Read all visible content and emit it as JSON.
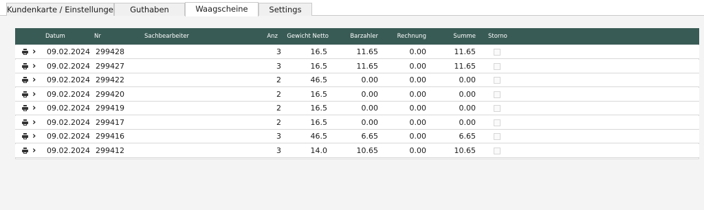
{
  "tabs": [
    {
      "label": "Kundenkarte / Einstellungen",
      "active": false
    },
    {
      "label": "Guthaben",
      "active": false
    },
    {
      "label": "Waagscheine",
      "active": true
    },
    {
      "label": "Settings",
      "active": false
    }
  ],
  "table": {
    "headers": {
      "datum": "Datum",
      "nr": "Nr",
      "sachbearbeiter": "Sachbearbeiter",
      "anz": "Anz",
      "gewicht": "Gewicht Netto",
      "barzahler": "Barzahler",
      "rechnung": "Rechnung",
      "summe": "Summe",
      "storno": "Storno"
    },
    "rows": [
      {
        "datum": "09.02.2024",
        "nr": "299428",
        "sachbearbeiter": "",
        "anz": "3",
        "gewicht": "16.5",
        "barzahler": "11.65",
        "rechnung": "0.00",
        "summe": "11.65",
        "storno": false
      },
      {
        "datum": "09.02.2024",
        "nr": "299427",
        "sachbearbeiter": "",
        "anz": "3",
        "gewicht": "16.5",
        "barzahler": "11.65",
        "rechnung": "0.00",
        "summe": "11.65",
        "storno": false
      },
      {
        "datum": "09.02.2024",
        "nr": "299422",
        "sachbearbeiter": "",
        "anz": "2",
        "gewicht": "46.5",
        "barzahler": "0.00",
        "rechnung": "0.00",
        "summe": "0.00",
        "storno": false
      },
      {
        "datum": "09.02.2024",
        "nr": "299420",
        "sachbearbeiter": "",
        "anz": "2",
        "gewicht": "16.5",
        "barzahler": "0.00",
        "rechnung": "0.00",
        "summe": "0.00",
        "storno": false
      },
      {
        "datum": "09.02.2024",
        "nr": "299419",
        "sachbearbeiter": "",
        "anz": "2",
        "gewicht": "16.5",
        "barzahler": "0.00",
        "rechnung": "0.00",
        "summe": "0.00",
        "storno": false
      },
      {
        "datum": "09.02.2024",
        "nr": "299417",
        "sachbearbeiter": "",
        "anz": "2",
        "gewicht": "16.5",
        "barzahler": "0.00",
        "rechnung": "0.00",
        "summe": "0.00",
        "storno": false
      },
      {
        "datum": "09.02.2024",
        "nr": "299416",
        "sachbearbeiter": "",
        "anz": "3",
        "gewicht": "46.5",
        "barzahler": "6.65",
        "rechnung": "0.00",
        "summe": "6.65",
        "storno": false
      },
      {
        "datum": "09.02.2024",
        "nr": "299412",
        "sachbearbeiter": "",
        "anz": "3",
        "gewicht": "14.0",
        "barzahler": "10.65",
        "rechnung": "0.00",
        "summe": "10.65",
        "storno": false
      }
    ],
    "row_icons": [
      "printer-icon",
      "chevron-right-icon"
    ]
  },
  "colors": {
    "header_bg": "#395b55",
    "header_text": "#ffffff",
    "panel_bg": "#f4f4f4"
  }
}
